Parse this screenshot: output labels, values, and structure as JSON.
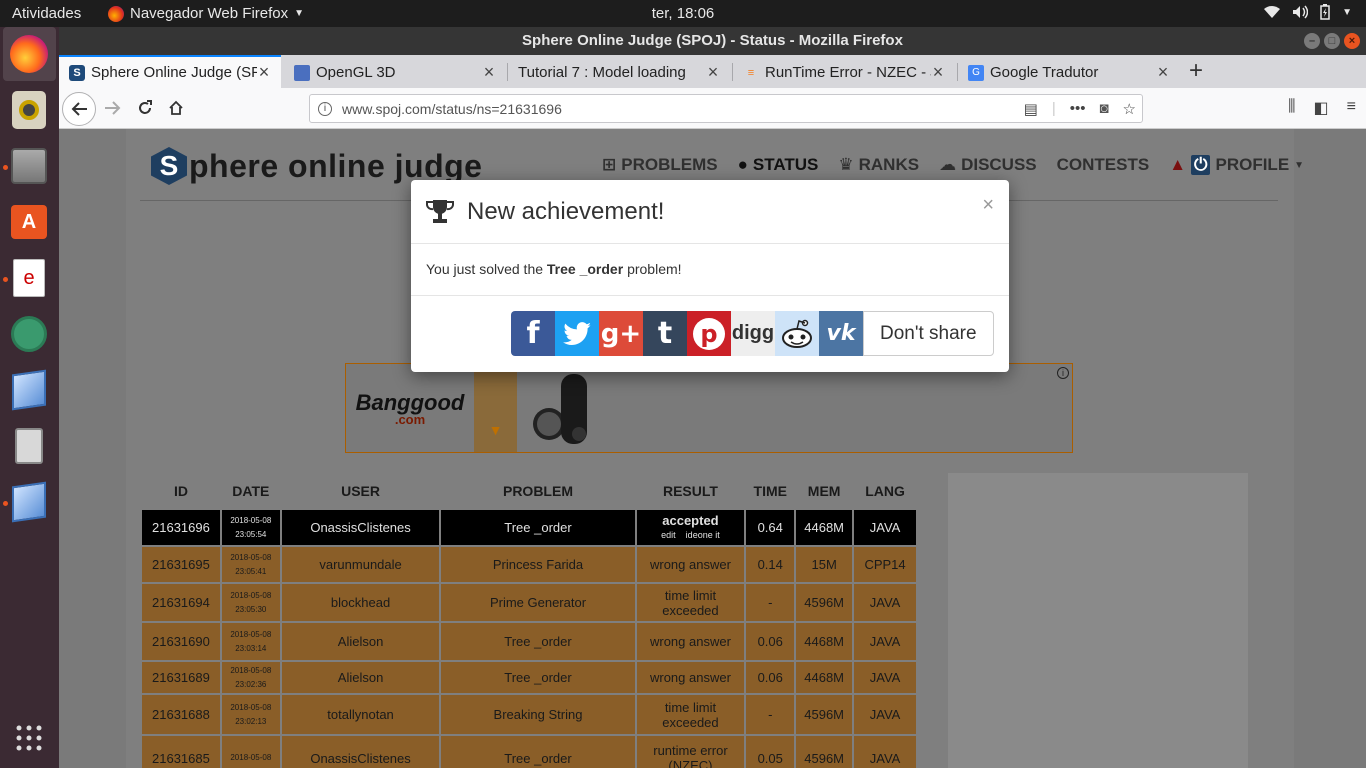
{
  "system": {
    "activities": "Atividades",
    "app_menu": "Navegador Web Firefox",
    "clock": "ter, 18:06"
  },
  "window": {
    "title": "Sphere Online Judge (SPOJ) - Status - Mozilla Firefox"
  },
  "tabs": [
    {
      "label": "Sphere Online Judge (SPOJ) - Status"
    },
    {
      "label": "OpenGL 3D"
    },
    {
      "label": "Tutorial 7 : Model loading"
    },
    {
      "label": "RunTime Error - NZEC - Java"
    },
    {
      "label": "Google Tradutor"
    }
  ],
  "urlbar": {
    "url": "www.spoj.com/status/ns=21631696"
  },
  "site": {
    "brand": "phere online judge",
    "brand_initial": "S",
    "nav": [
      "PROBLEMS",
      "STATUS",
      "RANKS",
      "DISCUSS",
      "CONTESTS",
      "PROFILE"
    ]
  },
  "ad": {
    "brand": "Banggood",
    "domain": ".com"
  },
  "table": {
    "headers": [
      "ID",
      "DATE",
      "USER",
      "PROBLEM",
      "RESULT",
      "TIME",
      "MEM",
      "LANG"
    ],
    "rows": [
      {
        "id": "21631696",
        "date1": "2018-05-08",
        "date2": "23:05:54",
        "user": "OnassisClistenes",
        "problem": "Tree _order",
        "result1": "accepted",
        "result2": "edit    ideone it",
        "time": "0.64",
        "mem": "4468M",
        "lang": "JAVA"
      },
      {
        "id": "21631695",
        "date1": "2018-05-08",
        "date2": "23:05:41",
        "user": "varunmundale",
        "problem": "Princess Farida",
        "result1": "wrong answer",
        "result2": "",
        "time": "0.14",
        "mem": "15M",
        "lang": "CPP14"
      },
      {
        "id": "21631694",
        "date1": "2018-05-08",
        "date2": "23:05:30",
        "user": "blockhead",
        "problem": "Prime Generator",
        "result1": "time limit",
        "result2": "exceeded",
        "time": "-",
        "mem": "4596M",
        "lang": "JAVA"
      },
      {
        "id": "21631690",
        "date1": "2018-05-08",
        "date2": "23:03:14",
        "user": "Alielson",
        "problem": "Tree _order",
        "result1": "wrong answer",
        "result2": "",
        "time": "0.06",
        "mem": "4468M",
        "lang": "JAVA"
      },
      {
        "id": "21631689",
        "date1": "2018-05-08",
        "date2": "23:02:36",
        "user": "Alielson",
        "problem": "Tree _order",
        "result1": "wrong answer",
        "result2": "",
        "time": "0.06",
        "mem": "4468M",
        "lang": "JAVA"
      },
      {
        "id": "21631688",
        "date1": "2018-05-08",
        "date2": "23:02:13",
        "user": "totallynotan",
        "problem": "Breaking String",
        "result1": "time limit",
        "result2": "exceeded",
        "time": "-",
        "mem": "4596M",
        "lang": "JAVA"
      },
      {
        "id": "21631685",
        "date1": "2018-05-08",
        "date2": "",
        "user": "OnassisClistenes",
        "problem": "Tree _order",
        "result1": "runtime error",
        "result2": "(NZEC)",
        "time": "0.05",
        "mem": "4596M",
        "lang": "JAVA"
      }
    ]
  },
  "modal": {
    "title": "New achievement!",
    "close": "×",
    "body_prefix": "You just solved the",
    "problem": "Tree _order",
    "body_suffix": "problem!",
    "share": [
      {
        "name": "facebook",
        "glyph": "f",
        "color": "#3b5998"
      },
      {
        "name": "twitter",
        "glyph": "t",
        "color": "#1da1f2"
      },
      {
        "name": "google-plus",
        "glyph": "g+",
        "color": "#dd4b39"
      },
      {
        "name": "tumblr",
        "glyph": "t",
        "color": "#35465c"
      },
      {
        "name": "pinterest",
        "glyph": "p",
        "color": "#cb2027"
      },
      {
        "name": "digg",
        "glyph": "digg",
        "color": "#eeeeee"
      },
      {
        "name": "reddit",
        "glyph": "r",
        "color": "#cee3f8"
      },
      {
        "name": "vk",
        "glyph": "vk",
        "color": "#4c75a3"
      }
    ],
    "dont_share": "Don't share"
  }
}
